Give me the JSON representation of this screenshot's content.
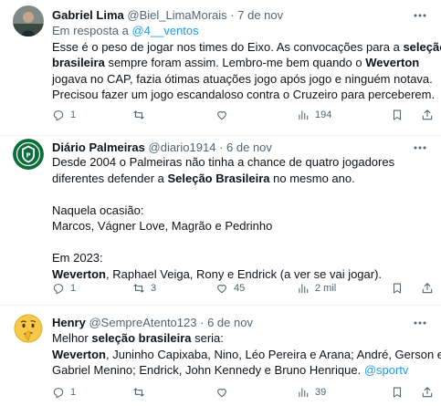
{
  "tweets": [
    {
      "name": "Gabriel Lima",
      "handle": "@Biel_LimaMorais",
      "sep": "·",
      "date": "7 de nov",
      "reply_prefix": "Em resposta a",
      "reply_to": "@4__ventos",
      "l1a": "Esse é o peso de jogar nos times do Eixo. As convocações para a ",
      "l1b": "seleção",
      "l2a": "brasileira",
      "l2b": " sempre foram assim. Lembro-me bem quando o ",
      "l2c": "Weverton",
      "l3": "jogava no CAP, fazia ótimas atuações jogo após jogo e ninguém notava.",
      "l4": "Precisou fazer um jogo escandaloso contra o Cruzeiro para perceberem.",
      "replies": "1",
      "retweets": "",
      "likes": "",
      "views": "194"
    },
    {
      "name": "Diário Palmeiras",
      "handle": "@diario1914",
      "sep": "·",
      "date": "6 de nov",
      "l1": "Desde 2004 o Palmeiras não tinha a chance de quatro jogadores",
      "l2a": "diferentes defender a ",
      "l2b": "Seleção Brasileira",
      "l2c": " no mesmo ano.",
      "l3": "Naquela ocasião:",
      "l4": "Marcos, Vágner Love, Magrão e Pedrinho",
      "l5": "Em 2023:",
      "l6a": "Weverton",
      "l6b": ", Raphael Veiga, Rony e Endrick (a ver se vai jogar).",
      "replies": "1",
      "retweets": "3",
      "likes": "45",
      "views": "2 mil"
    },
    {
      "name": "Henry",
      "handle": "@SempreAtento123",
      "sep": "·",
      "date": "6 de nov",
      "l1a": "Melhor ",
      "l1b": "seleção brasileira",
      "l1c": " seria:",
      "l2a": "Weverton",
      "l2b": ", Juninho Capixaba, Nino, Léo Pereira e Arana; André, Gerson e",
      "l3a": "Gabriel Menino; Endrick, John Kennedy e Bruno Henrique. ",
      "l3b": "@sportv",
      "replies": "1",
      "retweets": "",
      "likes": "",
      "views": "39"
    }
  ],
  "icons": {
    "reply": "reply-icon",
    "retweet": "retweet-icon",
    "like": "heart-icon",
    "views": "views-icon",
    "bookmark": "bookmark-icon",
    "share": "share-icon",
    "more": "more-icon"
  },
  "colors": {
    "link": "#1d9bf0",
    "muted": "#536471",
    "text": "#0f1419",
    "palmeiras": "#0d6e3b"
  }
}
